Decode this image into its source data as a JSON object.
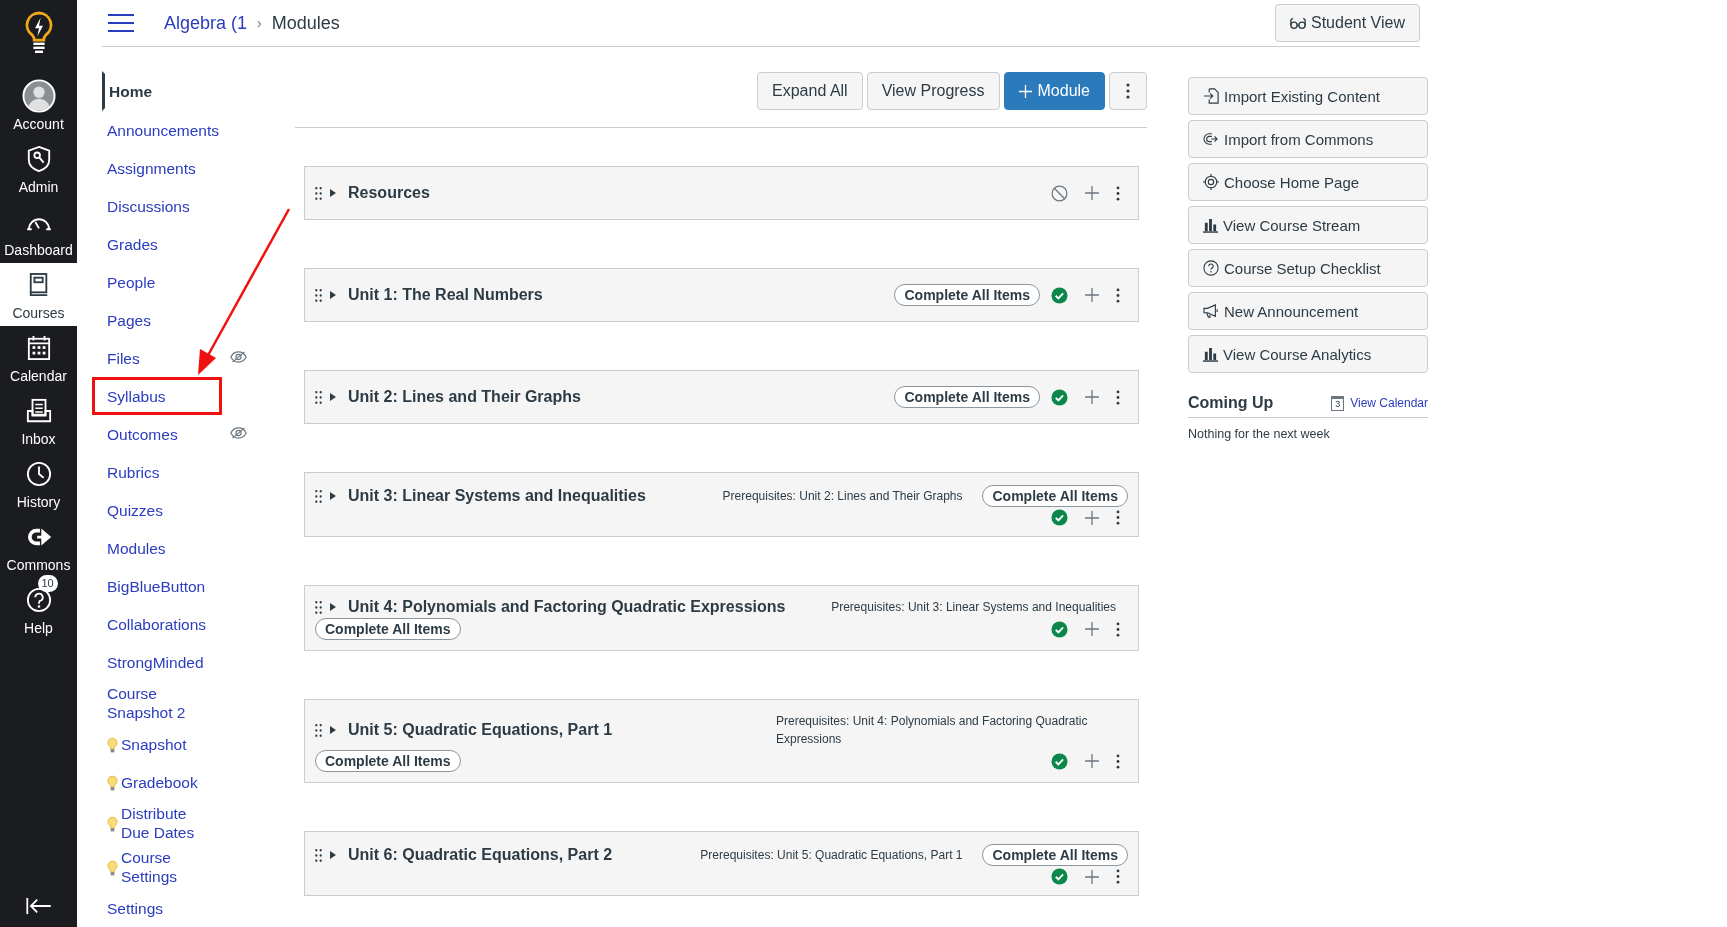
{
  "global_nav": [
    {
      "label": "Account",
      "selected": false
    },
    {
      "label": "Admin",
      "selected": false
    },
    {
      "label": "Dashboard",
      "selected": false
    },
    {
      "label": "Courses",
      "selected": true
    },
    {
      "label": "Calendar",
      "selected": false
    },
    {
      "label": "Inbox",
      "selected": false
    },
    {
      "label": "History",
      "selected": false
    },
    {
      "label": "Commons",
      "selected": false
    },
    {
      "label": "Help",
      "selected": false,
      "badge": "10"
    }
  ],
  "breadcrumb": {
    "course": "Algebra (1",
    "separator": "›",
    "page": "Modules"
  },
  "student_view": "Student View",
  "course_nav": [
    {
      "label": "Home",
      "selected": true,
      "hidden": false,
      "highlighted": false
    },
    {
      "label": "Announcements",
      "selected": false,
      "hidden": false,
      "highlighted": false
    },
    {
      "label": "Assignments",
      "selected": false,
      "hidden": false,
      "highlighted": false
    },
    {
      "label": "Discussions",
      "selected": false,
      "hidden": false,
      "highlighted": false
    },
    {
      "label": "Grades",
      "selected": false,
      "hidden": false,
      "highlighted": false
    },
    {
      "label": "People",
      "selected": false,
      "hidden": false,
      "highlighted": false
    },
    {
      "label": "Pages",
      "selected": false,
      "hidden": false,
      "highlighted": false
    },
    {
      "label": "Files",
      "selected": false,
      "hidden": true,
      "highlighted": false
    },
    {
      "label": "Syllabus",
      "selected": false,
      "hidden": false,
      "highlighted": true
    },
    {
      "label": "Outcomes",
      "selected": false,
      "hidden": true,
      "highlighted": false
    },
    {
      "label": "Rubrics",
      "selected": false,
      "hidden": false,
      "highlighted": false
    },
    {
      "label": "Quizzes",
      "selected": false,
      "hidden": false,
      "highlighted": false
    },
    {
      "label": "Modules",
      "selected": false,
      "hidden": false,
      "highlighted": false
    },
    {
      "label": "BigBlueButton",
      "selected": false,
      "hidden": false,
      "highlighted": false
    },
    {
      "label": "Collaborations",
      "selected": false,
      "hidden": false,
      "highlighted": false
    },
    {
      "label": "StrongMinded",
      "selected": false,
      "hidden": false,
      "highlighted": false
    },
    {
      "label": "Course Snapshot 2",
      "selected": false,
      "hidden": false,
      "highlighted": false
    },
    {
      "label": "Snapshot",
      "kind": "tool",
      "selected": false,
      "hidden": false,
      "highlighted": false
    },
    {
      "label": " Gradebook",
      "kind": "tool",
      "selected": false,
      "hidden": false,
      "highlighted": false
    },
    {
      "label": "Distribute Due Dates",
      "kind": "tool",
      "selected": false,
      "hidden": false,
      "highlighted": false
    },
    {
      "label": "Course Settings",
      "kind": "tool",
      "selected": false,
      "hidden": false,
      "highlighted": false
    },
    {
      "label": "Settings",
      "selected": false,
      "hidden": false,
      "highlighted": false
    }
  ],
  "toolbar": [
    "Expand All",
    "View Progress"
  ],
  "add_module": "Module",
  "modules": [
    {
      "title": "Resources",
      "published": false,
      "kind": "inline"
    },
    {
      "title": "Unit 1: The Real Numbers",
      "published": true,
      "kind": "inline",
      "requirement": "Complete All Items"
    },
    {
      "title": "Unit 2: Lines and Their Graphs",
      "published": true,
      "kind": "inline",
      "requirement": "Complete All Items"
    },
    {
      "title": "Unit 3: Linear Systems and Inequalities",
      "published": true,
      "kind": "top",
      "prerequisites": "Prerequisites: Unit 2: Lines and Their Graphs",
      "requirement": "Complete All Items"
    },
    {
      "title": "Unit 4: Polynomials and Factoring Quadratic Expressions",
      "published": true,
      "kind": "below",
      "prerequisites": "Prerequisites: Unit 3: Linear Systems and Inequalities",
      "requirement": "Complete All Items"
    },
    {
      "title": "Unit 5: Quadratic Equations, Part 1",
      "published": true,
      "kind": "below",
      "prerequisites": "Prerequisites: Unit 4: Polynomials and Factoring Quadratic Expressions",
      "requirement": "Complete All Items"
    },
    {
      "title": "Unit 6: Quadratic Equations, Part 2",
      "published": true,
      "kind": "top",
      "prerequisites": "Prerequisites: Unit 5: Quadratic Equations, Part 1",
      "requirement": "Complete All Items"
    }
  ],
  "sidebar_buttons": [
    "Import Existing Content",
    "Import from Commons",
    "Choose Home Page",
    "View Course Stream",
    "Course Setup Checklist",
    "New Announcement",
    "View Course Analytics"
  ],
  "coming_up": {
    "title": "Coming Up",
    "calendar_day": "3",
    "link": "View Calendar",
    "empty": "Nothing for the next week"
  }
}
